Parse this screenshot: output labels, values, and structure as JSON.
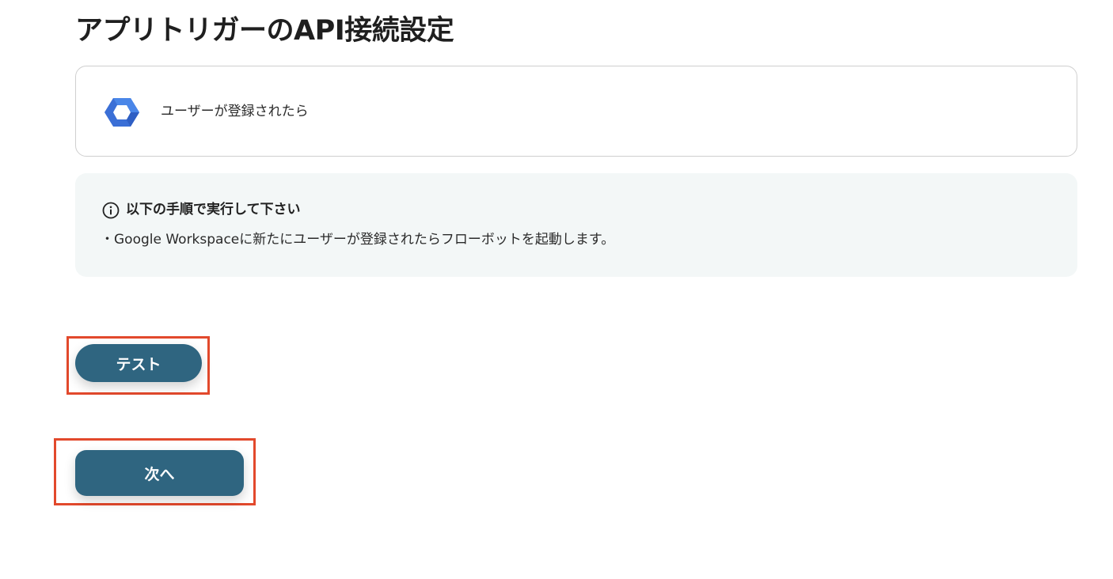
{
  "page": {
    "title": "アプリトリガーのAPI接続設定"
  },
  "trigger": {
    "icon": "google-workspace-icon",
    "label": "ユーザーが登録されたら"
  },
  "info": {
    "icon": "info-circle-icon",
    "heading": "以下の手順で実行して下さい",
    "text": "・Google Workspaceに新たにユーザーが登録されたらフローボットを起動します。"
  },
  "buttons": {
    "test_label": "テスト",
    "next_label": "次へ"
  },
  "colors": {
    "button": "#2f6580",
    "highlight": "#e2492c",
    "info_background": "#f3f7f7",
    "card_border": "#cfcfcf"
  }
}
